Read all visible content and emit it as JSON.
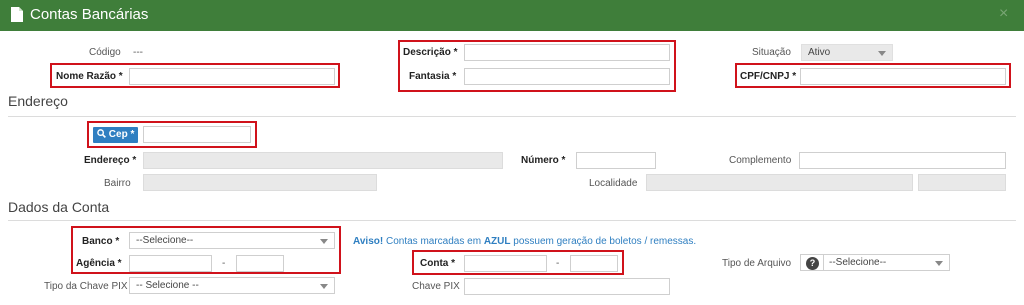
{
  "header": {
    "title": "Contas Bancárias",
    "close_label": "×"
  },
  "form": {
    "codigo_label": "Código",
    "codigo_value": "---",
    "nome_razao_label": "Nome Razão *",
    "descricao_label": "Descrição *",
    "fantasia_label": "Fantasia *",
    "situacao_label": "Situação",
    "situacao_value": "Ativo",
    "cpf_cnpj_label": "CPF/CNPJ *"
  },
  "endereco": {
    "section_title": "Endereço",
    "cep_label": "Cep *",
    "endereco_label": "Endereço *",
    "numero_label": "Número *",
    "complemento_label": "Complemento",
    "bairro_label": "Bairro",
    "localidade_label": "Localidade"
  },
  "dados_conta": {
    "section_title": "Dados da Conta",
    "banco_label": "Banco *",
    "banco_value": "--Selecione--",
    "aviso_prefix": "Aviso!",
    "aviso_middle": " Contas marcadas em ",
    "aviso_highlight": "AZUL",
    "aviso_suffix": " possuem geração de boletos / remessas.",
    "agencia_label": "Agência *",
    "conta_label": "Conta *",
    "separator": "-",
    "tipo_arquivo_label": "Tipo de Arquivo",
    "tipo_arquivo_value": "--Selecione--",
    "tipo_chave_pix_label": "Tipo da Chave PIX",
    "tipo_chave_pix_value": "-- Selecione --",
    "chave_pix_label": "Chave PIX"
  },
  "colors": {
    "header_bg": "#3f7e3a",
    "highlight_box": "#d0121b",
    "accent_blue": "#2f7fc1"
  },
  "icons": {
    "header": "document-icon",
    "close": "close-icon",
    "cep": "search-icon",
    "help": "question-icon"
  }
}
